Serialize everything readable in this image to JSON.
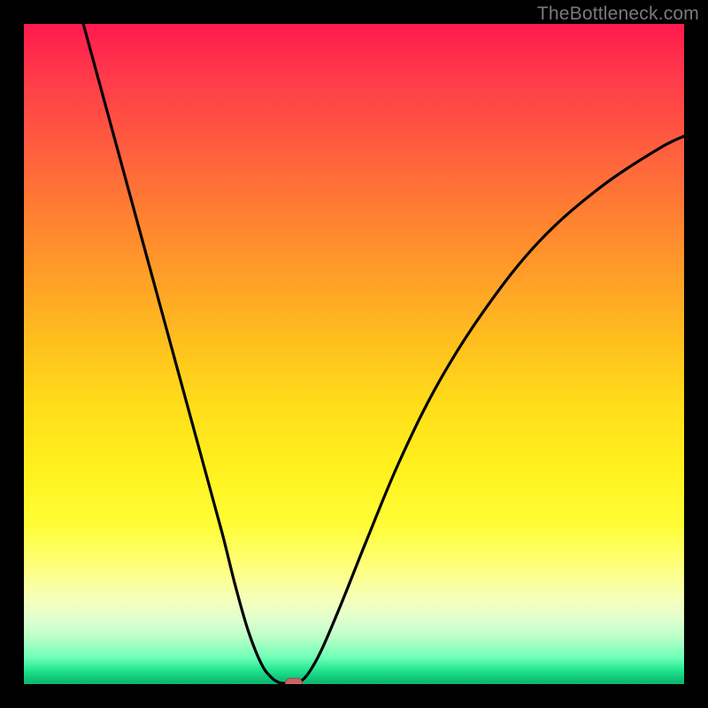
{
  "watermark": "TheBottleneck.com",
  "colors": {
    "frame": "#000000",
    "curve": "#000000",
    "marker_fill": "#c66565",
    "marker_border": "#9a4848"
  },
  "chart_data": {
    "type": "line",
    "title": "",
    "xlabel": "",
    "ylabel": "",
    "xlim": [
      0,
      100
    ],
    "ylim": [
      0,
      100
    ],
    "grid": false,
    "legend": false,
    "series": [
      {
        "name": "left-branch",
        "x": [
          9,
          12,
          15,
          18,
          21,
          24,
          27,
          30,
          32,
          34,
          36,
          37.5,
          38.5,
          39.4
        ],
        "y": [
          100,
          89,
          78,
          67,
          56,
          45,
          34,
          23,
          15,
          8,
          3,
          1,
          0.3,
          0.1
        ]
      },
      {
        "name": "right-branch",
        "x": [
          41.5,
          43,
          45,
          48,
          52,
          57,
          63,
          70,
          78,
          87,
          96,
          100
        ],
        "y": [
          0.1,
          1.5,
          5,
          12,
          22,
          34,
          46,
          57,
          67,
          75,
          81,
          83
        ]
      }
    ],
    "flat_segment": {
      "x_start": 39.4,
      "x_end": 41.5,
      "y": 0.1
    },
    "marker": {
      "x": 40.8,
      "y": 0.1
    },
    "background_gradient": [
      {
        "pos": 0.0,
        "color": "#ff1a4e"
      },
      {
        "pos": 0.5,
        "color": "#ffd41c"
      },
      {
        "pos": 0.8,
        "color": "#fdff6a"
      },
      {
        "pos": 0.92,
        "color": "#cfffce"
      },
      {
        "pos": 1.0,
        "color": "#0fb36e"
      }
    ]
  }
}
